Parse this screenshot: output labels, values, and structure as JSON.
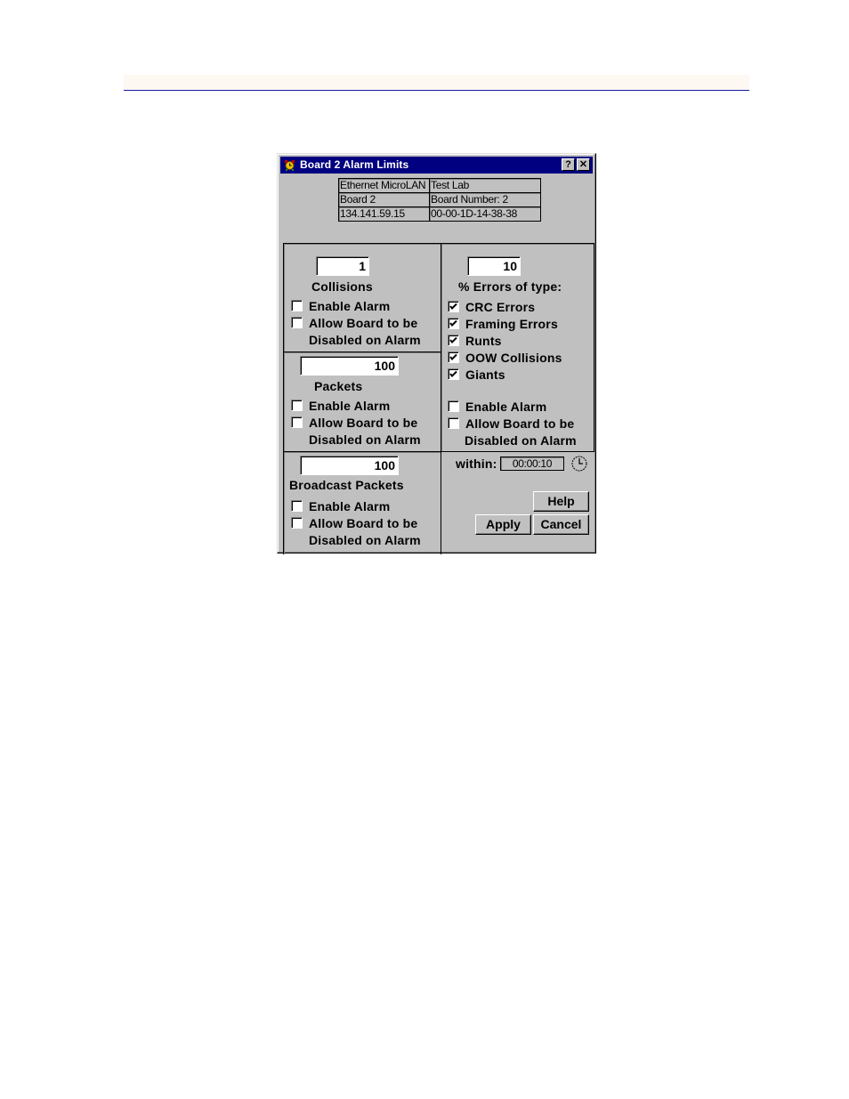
{
  "page": {
    "header_rule_color": "#1a1aa8"
  },
  "dialog": {
    "title": "Board 2 Alarm Limits",
    "title_icon": "bell-alarm-icon",
    "help_button": "?",
    "close_button": "✕",
    "info_table": [
      [
        "Ethernet MicroLAN",
        "Test Lab"
      ],
      [
        "Board 2",
        "Board Number:  2"
      ],
      [
        "134.141.59.15",
        "00-00-1D-14-38-38"
      ]
    ],
    "collisions": {
      "value": "1",
      "label": "Collisions",
      "enable_alarm": {
        "label": "Enable Alarm",
        "checked": false
      },
      "allow_disable": {
        "label_line1": "Allow Board to be",
        "label_line2": "Disabled on Alarm",
        "checked": false
      }
    },
    "packets": {
      "value": "100",
      "label": "Packets",
      "enable_alarm": {
        "label": "Enable Alarm",
        "checked": false
      },
      "allow_disable": {
        "label_line1": "Allow Board to be",
        "label_line2": "Disabled on Alarm",
        "checked": false
      }
    },
    "broadcast": {
      "value": "100",
      "label": "Broadcast Packets",
      "enable_alarm": {
        "label": "Enable Alarm",
        "checked": false
      },
      "allow_disable": {
        "label_line1": "Allow Board to be",
        "label_line2": "Disabled on Alarm",
        "checked": false
      }
    },
    "errors": {
      "value": "10",
      "label": "% Errors of type:",
      "types": [
        {
          "label": "CRC Errors",
          "checked": true
        },
        {
          "label": "Framing Errors",
          "checked": true
        },
        {
          "label": "Runts",
          "checked": true
        },
        {
          "label": "OOW Collisions",
          "checked": true
        },
        {
          "label": "Giants",
          "checked": true
        }
      ],
      "enable_alarm": {
        "label": "Enable Alarm",
        "checked": false
      },
      "allow_disable": {
        "label_line1": "Allow Board to be",
        "label_line2": "Disabled on Alarm",
        "checked": false
      }
    },
    "within": {
      "label": "within:",
      "value": "00:00:10",
      "icon": "clock-icon"
    },
    "buttons": {
      "help": "Help",
      "apply": "Apply",
      "cancel": "Cancel"
    }
  }
}
